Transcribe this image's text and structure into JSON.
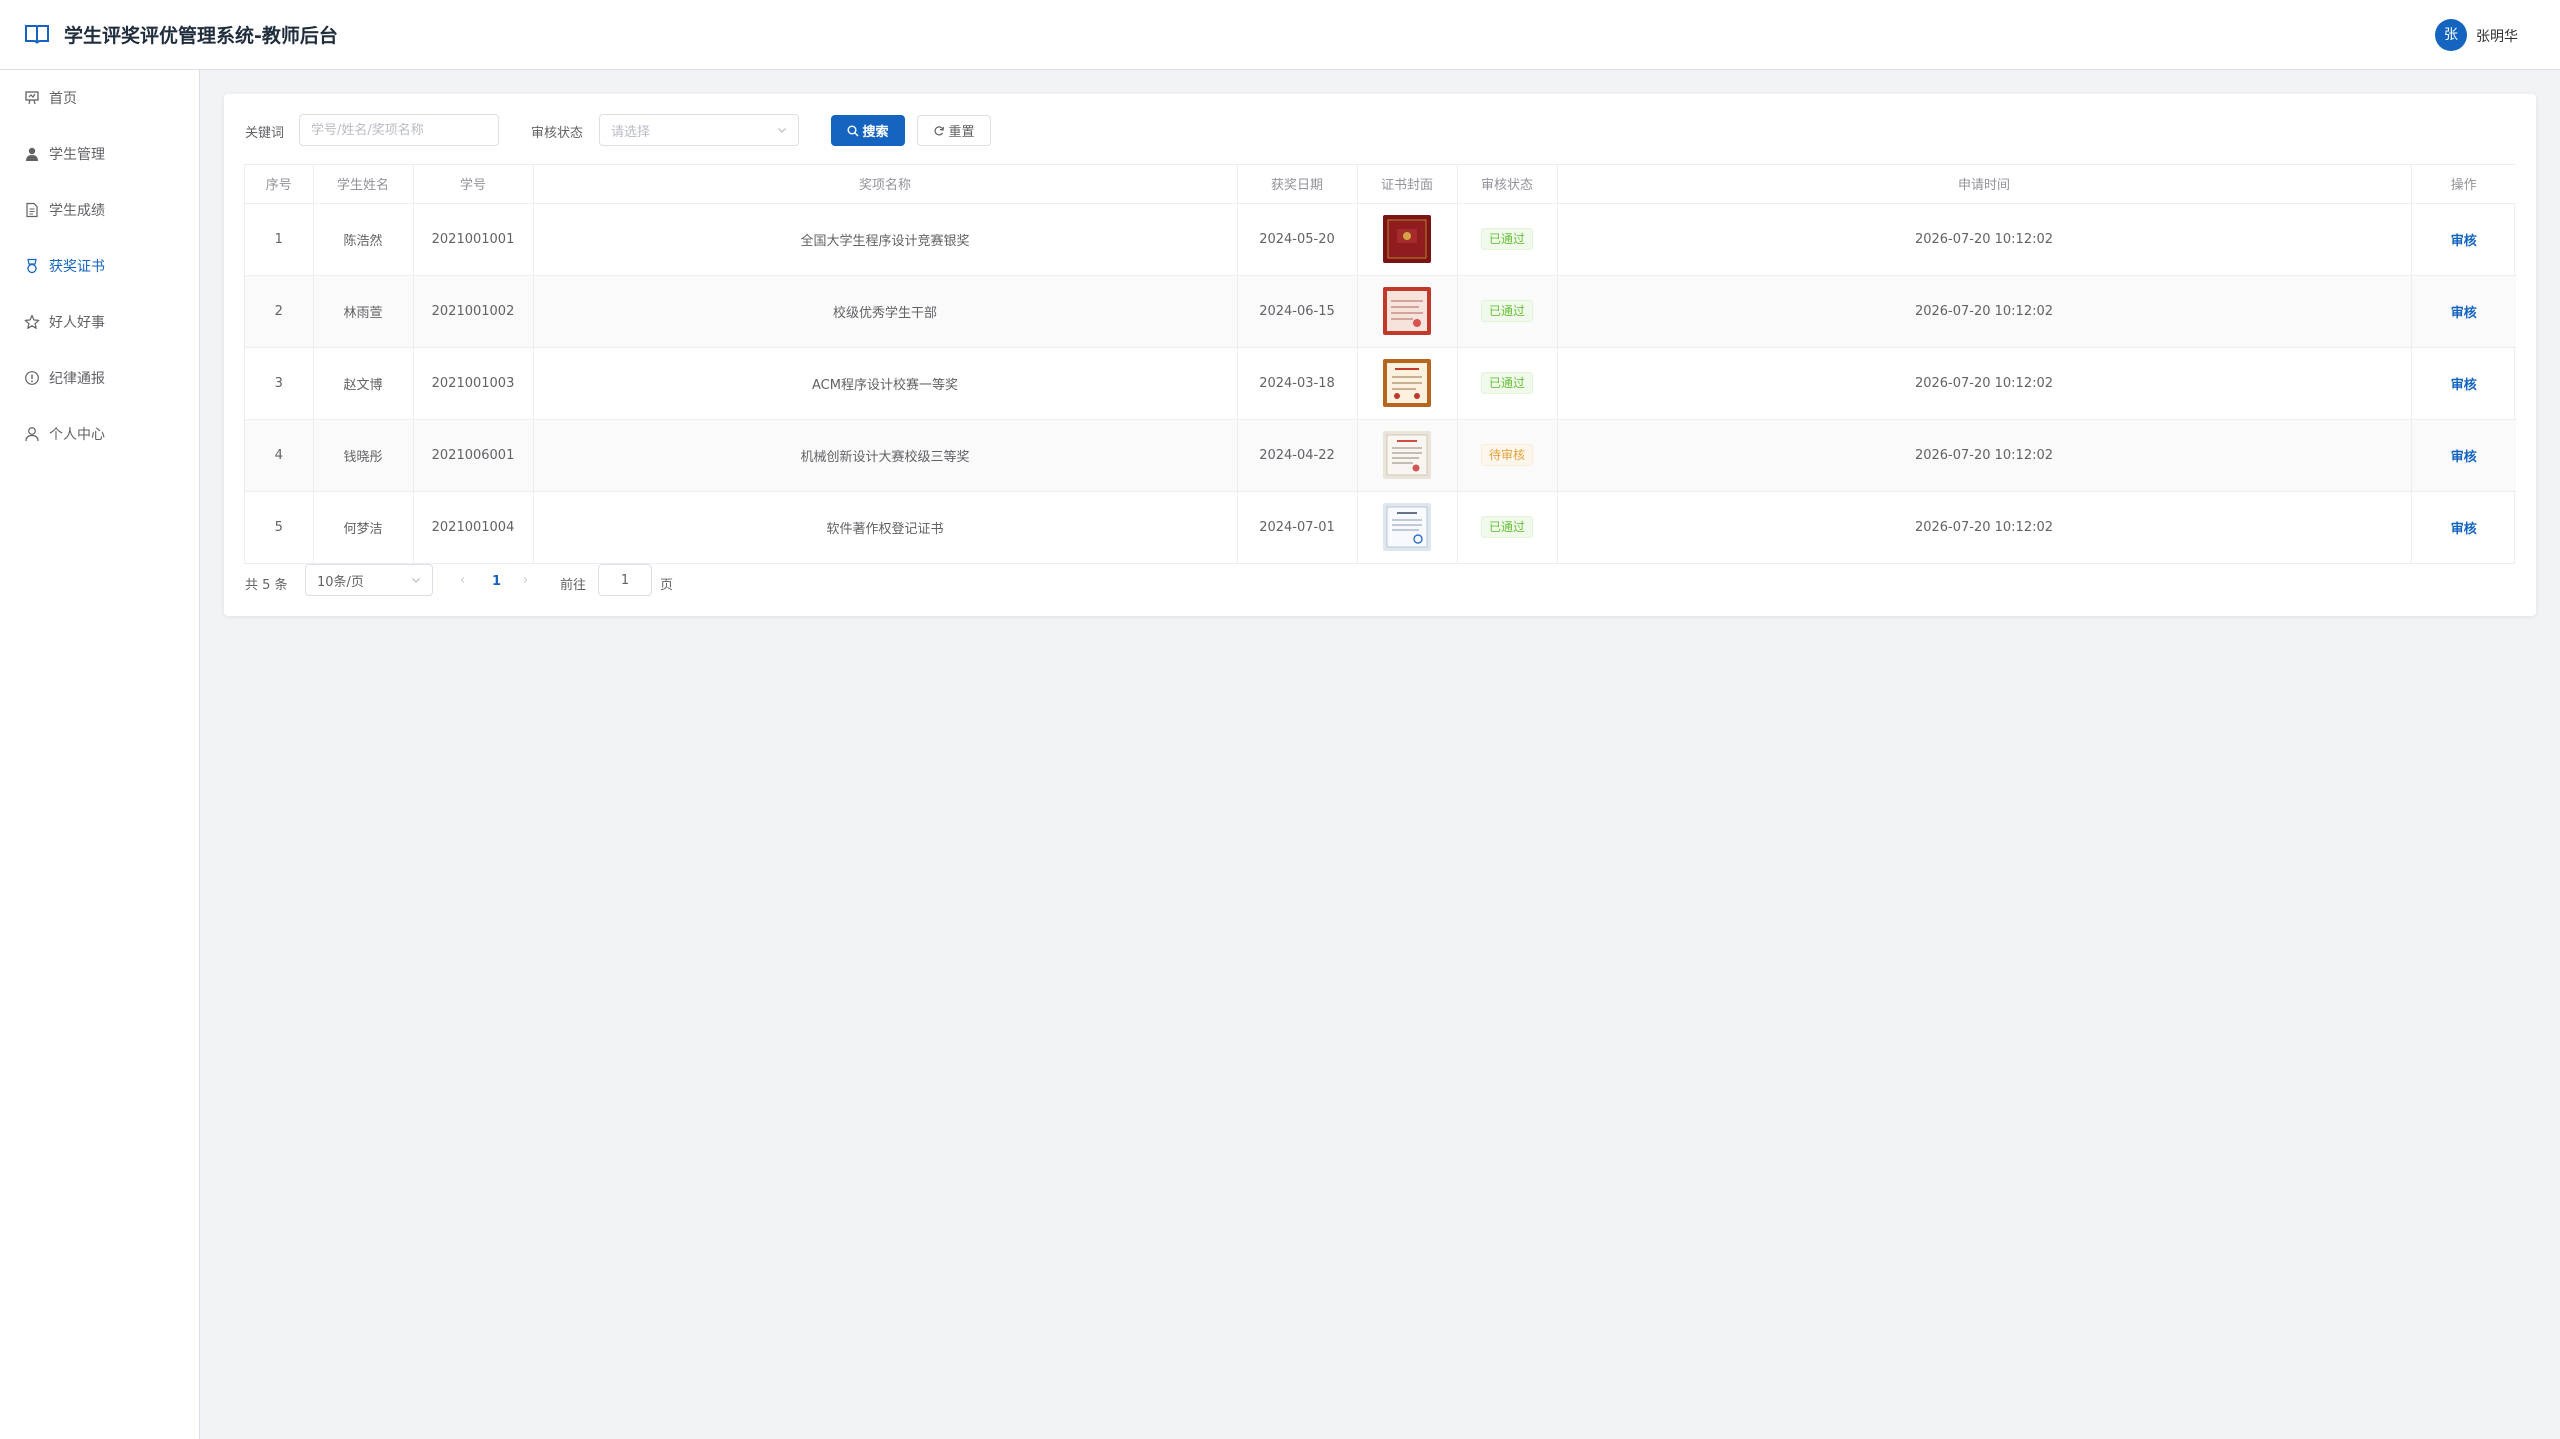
{
  "header": {
    "title": "学生评奖评优管理系统-教师后台",
    "avatar_text": "张",
    "user_name": "张明华"
  },
  "sidebar": {
    "items": [
      {
        "label": "首页",
        "icon": "dashboard-icon"
      },
      {
        "label": "学生管理",
        "icon": "user-icon"
      },
      {
        "label": "学生成绩",
        "icon": "document-icon"
      },
      {
        "label": "获奖证书",
        "icon": "medal-icon",
        "active": true
      },
      {
        "label": "好人好事",
        "icon": "star-icon"
      },
      {
        "label": "纪律通报",
        "icon": "warning-icon"
      },
      {
        "label": "个人中心",
        "icon": "person-icon"
      }
    ]
  },
  "filters": {
    "keyword_label": "关键词",
    "keyword_placeholder": "学号/姓名/奖项名称",
    "status_label": "审核状态",
    "status_placeholder": "请选择",
    "search_label": "搜索",
    "reset_label": "重置"
  },
  "table": {
    "columns": [
      "序号",
      "学生姓名",
      "学号",
      "奖项名称",
      "获奖日期",
      "证书封面",
      "审核状态",
      "申请时间",
      "操作"
    ],
    "rows": [
      {
        "index": "1",
        "name": "陈浩然",
        "student_id": "2021001001",
        "award": "全国大学生程序设计竞赛银奖",
        "date": "2024-05-20",
        "status": "已通过",
        "status_type": "success",
        "applied": "2026-07-20 10:12:02",
        "action": "审核"
      },
      {
        "index": "2",
        "name": "林雨萱",
        "student_id": "2021001002",
        "award": "校级优秀学生干部",
        "date": "2024-06-15",
        "status": "已通过",
        "status_type": "success",
        "applied": "2026-07-20 10:12:02",
        "action": "审核"
      },
      {
        "index": "3",
        "name": "赵文博",
        "student_id": "2021001003",
        "award": "ACM程序设计校赛一等奖",
        "date": "2024-03-18",
        "status": "已通过",
        "status_type": "success",
        "applied": "2026-07-20 10:12:02",
        "action": "审核"
      },
      {
        "index": "4",
        "name": "钱晓彤",
        "student_id": "2021006001",
        "award": "机械创新设计大赛校级三等奖",
        "date": "2024-04-22",
        "status": "待审核",
        "status_type": "warning",
        "applied": "2026-07-20 10:12:02",
        "action": "审核"
      },
      {
        "index": "5",
        "name": "何梦洁",
        "student_id": "2021001004",
        "award": "软件著作权登记证书",
        "date": "2024-07-01",
        "status": "已通过",
        "status_type": "success",
        "applied": "2026-07-20 10:12:02",
        "action": "审核"
      }
    ]
  },
  "pagination": {
    "total": "共 5 条",
    "page_size": "10条/页",
    "current_page": "1",
    "goto_label": "前往",
    "goto_value": "1",
    "page_suffix": "页"
  },
  "colors": {
    "primary": "#1565c0",
    "success": "#67c23a",
    "warning": "#e6a23c"
  }
}
